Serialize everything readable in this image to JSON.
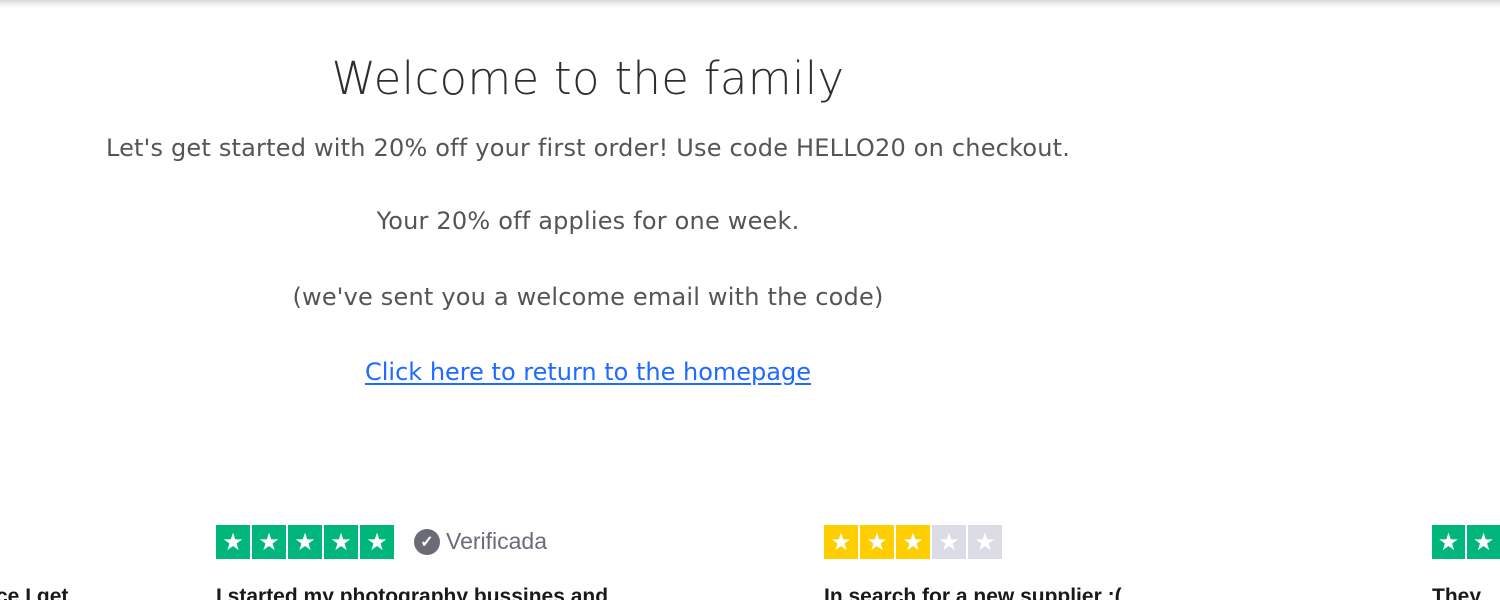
{
  "welcome": {
    "title": "Welcome to the family",
    "line1": "Let's get started with 20% off your first order! Use code HELLO20 on checkout.",
    "line2": "Your 20% off applies for one week.",
    "line3": "(we've sent you a welcome email with the code)",
    "home_link": "Click here to return to the homepage"
  },
  "reviews": [
    {
      "headline": "ce I get"
    },
    {
      "stars": 5,
      "verified_label": "Verificada",
      "headline": "I started my photography bussines and"
    },
    {
      "stars": 3,
      "headline": "In search for a new supplier :("
    },
    {
      "headline": "They"
    }
  ],
  "colors": {
    "trustpilot_green": "#00b67a",
    "star_yellow": "#ffce00",
    "star_empty": "#dcdce6",
    "link_blue": "#1f6bff"
  }
}
